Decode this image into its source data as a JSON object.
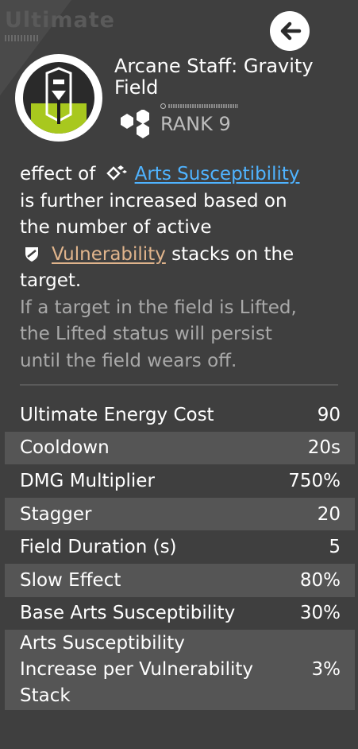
{
  "header": {
    "title": "Ultimate"
  },
  "skill": {
    "name_line1": "Arcane Staff: Gravity",
    "name_line2": "Field",
    "rank_label": "RANK 9"
  },
  "description": {
    "l1_pre": "effect of",
    "l1_keyword": "Arts Susceptibility",
    "l2": "is further increased based on",
    "l3": "the number of active",
    "l4_keyword": "Vulnerability",
    "l4_post": "stacks on the",
    "l5": "target.",
    "note1": "If a target in the field is Lifted,",
    "note2": "the Lifted status will persist",
    "note3": "until the field wears off."
  },
  "stats": [
    {
      "label": "Ultimate Energy Cost",
      "value": "90"
    },
    {
      "label": "Cooldown",
      "value": "20s"
    },
    {
      "label": "DMG Multiplier",
      "value": "750%"
    },
    {
      "label": "Stagger",
      "value": "20"
    },
    {
      "label": "Field Duration (s)",
      "value": "5"
    },
    {
      "label": "Slow Effect",
      "value": "80%"
    },
    {
      "label": "Base Arts Susceptibility",
      "value": "30%"
    },
    {
      "label_line1": "Arts Susceptibility",
      "label_line2": "Increase per Vulnerability",
      "label_line3": "Stack",
      "value": "3%"
    }
  ],
  "colors": {
    "keyword_arts": "#4fb3ff",
    "keyword_vulnerability": "#e0b48c",
    "icon_green": "#a8c81e"
  },
  "icons": {
    "back": "back-arrow-icon",
    "skill": "skill-emblem-icon",
    "rank": "rank-hexagon-icon",
    "arts": "arts-susceptibility-icon",
    "vulnerability": "vulnerability-shield-icon"
  }
}
